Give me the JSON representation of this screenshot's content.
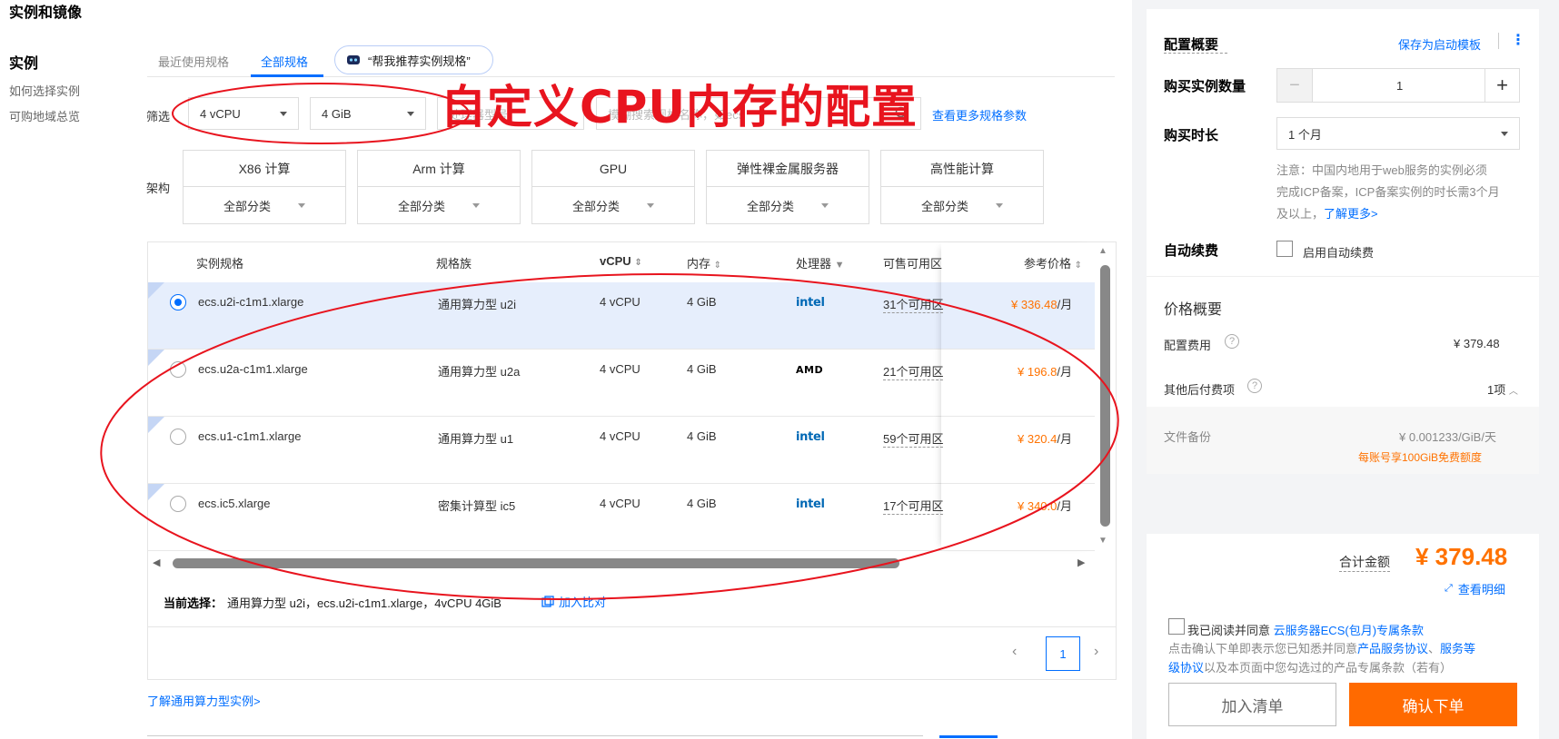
{
  "page": {
    "title": "实例和镜像"
  },
  "sidebar": {
    "title": "实例",
    "links": [
      "如何选择实例",
      "可购地域总览"
    ]
  },
  "tabs": {
    "recent": "最近使用规格",
    "all": "全部规格",
    "ai_recommend": "“帮我推荐实例规格”"
  },
  "filter": {
    "label": "筛选",
    "vcpu": "4 vCPU",
    "memory": "4 GiB",
    "model_placeholder": "处理器型号",
    "search_placeholder": "模糊搜索规格名称，如ecs",
    "more_params_link": "查看更多规格参数"
  },
  "annotation": {
    "text": "自定义CPU内存的配置"
  },
  "arch": {
    "label": "架构",
    "cards": [
      {
        "title": "X86 计算",
        "category": "全部分类"
      },
      {
        "title": "Arm 计算",
        "category": "全部分类"
      },
      {
        "title": "GPU",
        "category": "全部分类"
      },
      {
        "title": "弹性裸金属服务器",
        "category": "全部分类"
      },
      {
        "title": "高性能计算",
        "category": "全部分类"
      }
    ]
  },
  "table": {
    "headers": {
      "spec": "实例规格",
      "family": "规格族",
      "vcpu": "vCPU",
      "memory": "内存",
      "processor": "处理器",
      "zones": "可售可用区",
      "price": "参考价格"
    },
    "rows": [
      {
        "spec": "ecs.u2i-c1m1.xlarge",
        "family": "通用算力型 u2i",
        "vcpu": "4 vCPU",
        "memory": "4 GiB",
        "processor": "intel",
        "zones": "31个可用区",
        "price": "¥ 336.48",
        "unit": "/月",
        "selected": true
      },
      {
        "spec": "ecs.u2a-c1m1.xlarge",
        "family": "通用算力型 u2a",
        "vcpu": "4 vCPU",
        "memory": "4 GiB",
        "processor": "AMD",
        "zones": "21个可用区",
        "price": "¥ 196.8",
        "unit": "/月",
        "selected": false
      },
      {
        "spec": "ecs.u1-c1m1.xlarge",
        "family": "通用算力型 u1",
        "vcpu": "4 vCPU",
        "memory": "4 GiB",
        "processor": "intel",
        "zones": "59个可用区",
        "price": "¥ 320.4",
        "unit": "/月",
        "selected": false
      },
      {
        "spec": "ecs.ic5.xlarge",
        "family": "密集计算型 ic5",
        "vcpu": "4 vCPU",
        "memory": "4 GiB",
        "processor": "intel",
        "zones": "17个可用区",
        "price": "¥ 340.0",
        "unit": "/月",
        "selected": false
      }
    ],
    "current_selection_label": "当前选择：",
    "current_selection": "通用算力型 u2i，ecs.u2i-c1m1.xlarge，4vCPU 4GiB",
    "add_compare": "加入比对",
    "page": "1"
  },
  "learn_more_link": "了解通用算力型实例>",
  "right": {
    "config_summary": "配置概要",
    "save_template": "保存为启动模板",
    "quantity_label": "购买实例数量",
    "quantity": "1",
    "duration_label": "购买时长",
    "duration": "1 个月",
    "notice_1": "注意：中国内地用于web服务的实例必须",
    "notice_2": "完成ICP备案，ICP备案实例的时长需3个月",
    "notice_3": "及以上，",
    "notice_link": "了解更多>",
    "auto_renew_label": "自动续费",
    "auto_renew_option": "启用自动续费",
    "price_summary": "价格概要",
    "config_fee_label": "配置费用",
    "config_fee": "¥ 379.48",
    "other_fee_label": "其他后付费项",
    "other_fee_count": "1项",
    "backup_label": "文件备份",
    "backup_price": "¥ 0.001233/GiB/天",
    "backup_free": "每账号享100GiB免费额度",
    "total_label": "合计金额",
    "total": "¥ 379.48",
    "view_detail": "查看明细",
    "agree_text": "我已阅读并同意",
    "agree_link": "云服务器ECS(包月)专属条款",
    "terms_1": "点击确认下单即表示您已知悉并同意",
    "terms_link_1": "产品服务协议",
    "terms_sep": "、",
    "terms_link_2a": "服务等",
    "terms_link_2b": "级协议",
    "terms_2": "以及本页面中您勾选过的产品专属条款（若有）",
    "add_cart": "加入清单",
    "confirm_order": "确认下单"
  },
  "colors": {
    "accent": "#006eff",
    "price": "#ff7200",
    "annotation": "#e8141e",
    "order_button": "#ff6a00"
  }
}
